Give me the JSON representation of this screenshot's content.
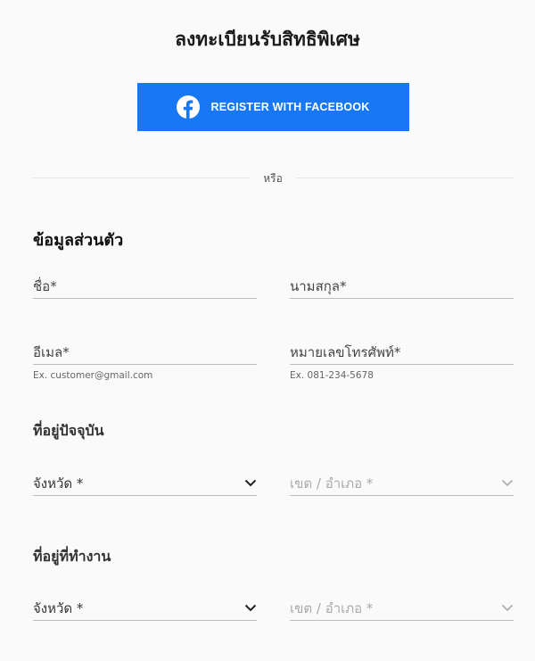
{
  "title": "ลงทะเบียนรับสิทธิพิเศษ",
  "facebook_button": {
    "label": "REGISTER WITH FACEBOOK",
    "icon": "facebook-icon",
    "color": "#1877f2"
  },
  "divider_text": "หรือ",
  "personal": {
    "heading": "ข้อมูลส่วนตัว",
    "first_name": {
      "placeholder": "ชื่อ*",
      "value": ""
    },
    "last_name": {
      "placeholder": "นามสกุล*",
      "value": ""
    },
    "email": {
      "placeholder": "อีเมล*",
      "value": "",
      "hint": "Ex. customer@gmail.com"
    },
    "phone": {
      "placeholder": "หมายเลขโทรศัพท์*",
      "value": "",
      "hint": "Ex. 081-234-5678"
    }
  },
  "current_address": {
    "heading": "ที่อยู่ปัจจุบัน",
    "province": {
      "label": "จังหวัด *",
      "enabled": true
    },
    "district": {
      "label": "เขต / อำเภอ *",
      "enabled": false
    }
  },
  "work_address": {
    "heading": "ที่อยู่ที่ทำงาน",
    "province": {
      "label": "จังหวัด *",
      "enabled": true
    },
    "district": {
      "label": "เขต / อำเภอ *",
      "enabled": false
    }
  }
}
